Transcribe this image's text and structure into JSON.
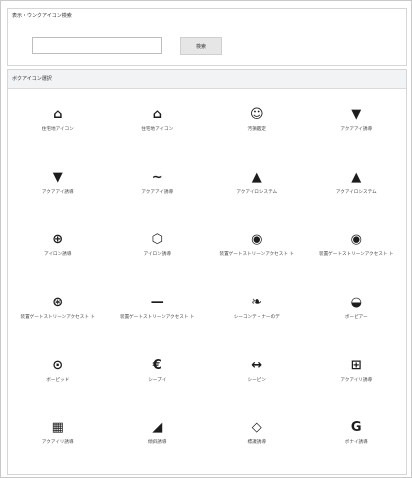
{
  "search_panel": {
    "title": "表示・ウンクアイコン検索",
    "input_value": "",
    "input_placeholder": "",
    "button_label": "検索"
  },
  "list_panel": {
    "header": "ボクアイコン選択"
  },
  "icons": [
    {
      "name": "home-icon",
      "glyph": "⌂",
      "label": "住宅地アイコン"
    },
    {
      "name": "house-solid-icon",
      "glyph": "⌂",
      "label": "住宅地アイコン"
    },
    {
      "name": "circle-face-icon",
      "glyph": "☺",
      "label": "汚損鑑定"
    },
    {
      "name": "waterfall-icon",
      "glyph": "▼",
      "label": "アクアアイ誘導"
    },
    {
      "name": "waterfall-small-icon",
      "glyph": "▼",
      "label": "アクアアイ誘導"
    },
    {
      "name": "wave-icon",
      "glyph": "∼",
      "label": "アクアアイ誘導"
    },
    {
      "name": "triangle-solid-icon",
      "glyph": "▲",
      "label": "アクアイロシステム"
    },
    {
      "name": "triangle-outline-icon",
      "glyph": "▲",
      "label": "アクアイロシステム"
    },
    {
      "name": "grid-circle-icon",
      "glyph": "⊕",
      "label": "アイロン誘導"
    },
    {
      "name": "hexagon-icon",
      "glyph": "⬡",
      "label": "アイロン誘導"
    },
    {
      "name": "person-circle-icon",
      "glyph": "◉",
      "label": "装置ゲートストリーンアクセスト ト"
    },
    {
      "name": "person-circle-2-icon",
      "glyph": "◉",
      "label": "装置ゲートストリーンアクセスト ト"
    },
    {
      "name": "globe-icon",
      "glyph": "⊛",
      "label": "装置ゲートストリーンアクセスト ト"
    },
    {
      "name": "dash-icon",
      "glyph": "—",
      "label": "装置ゲートストリーンアクセスト ト"
    },
    {
      "name": "leaf-icon",
      "glyph": "❧",
      "label": "シーコンテ・ナーのデ"
    },
    {
      "name": "cup-icon",
      "glyph": "◒",
      "label": "ボーピアー"
    },
    {
      "name": "binoculars-icon",
      "glyph": "⊙",
      "label": "ボーピッド"
    },
    {
      "name": "c-letter-icon",
      "glyph": "€",
      "label": "シープイ"
    },
    {
      "name": "arrows-icon",
      "glyph": "↔",
      "label": "シーピン"
    },
    {
      "name": "grid-square-icon",
      "glyph": "⊞",
      "label": "アクアイリ誘導"
    },
    {
      "name": "tiles-icon",
      "glyph": "▦",
      "label": "アクアイリ誘導"
    },
    {
      "name": "ramp-icon",
      "glyph": "◢",
      "label": "傾斜誘導"
    },
    {
      "name": "diamond-icon",
      "glyph": "◇",
      "label": "標識誘導"
    },
    {
      "name": "g-letter-icon",
      "glyph": "G",
      "label": "ボナイ誘導"
    }
  ]
}
